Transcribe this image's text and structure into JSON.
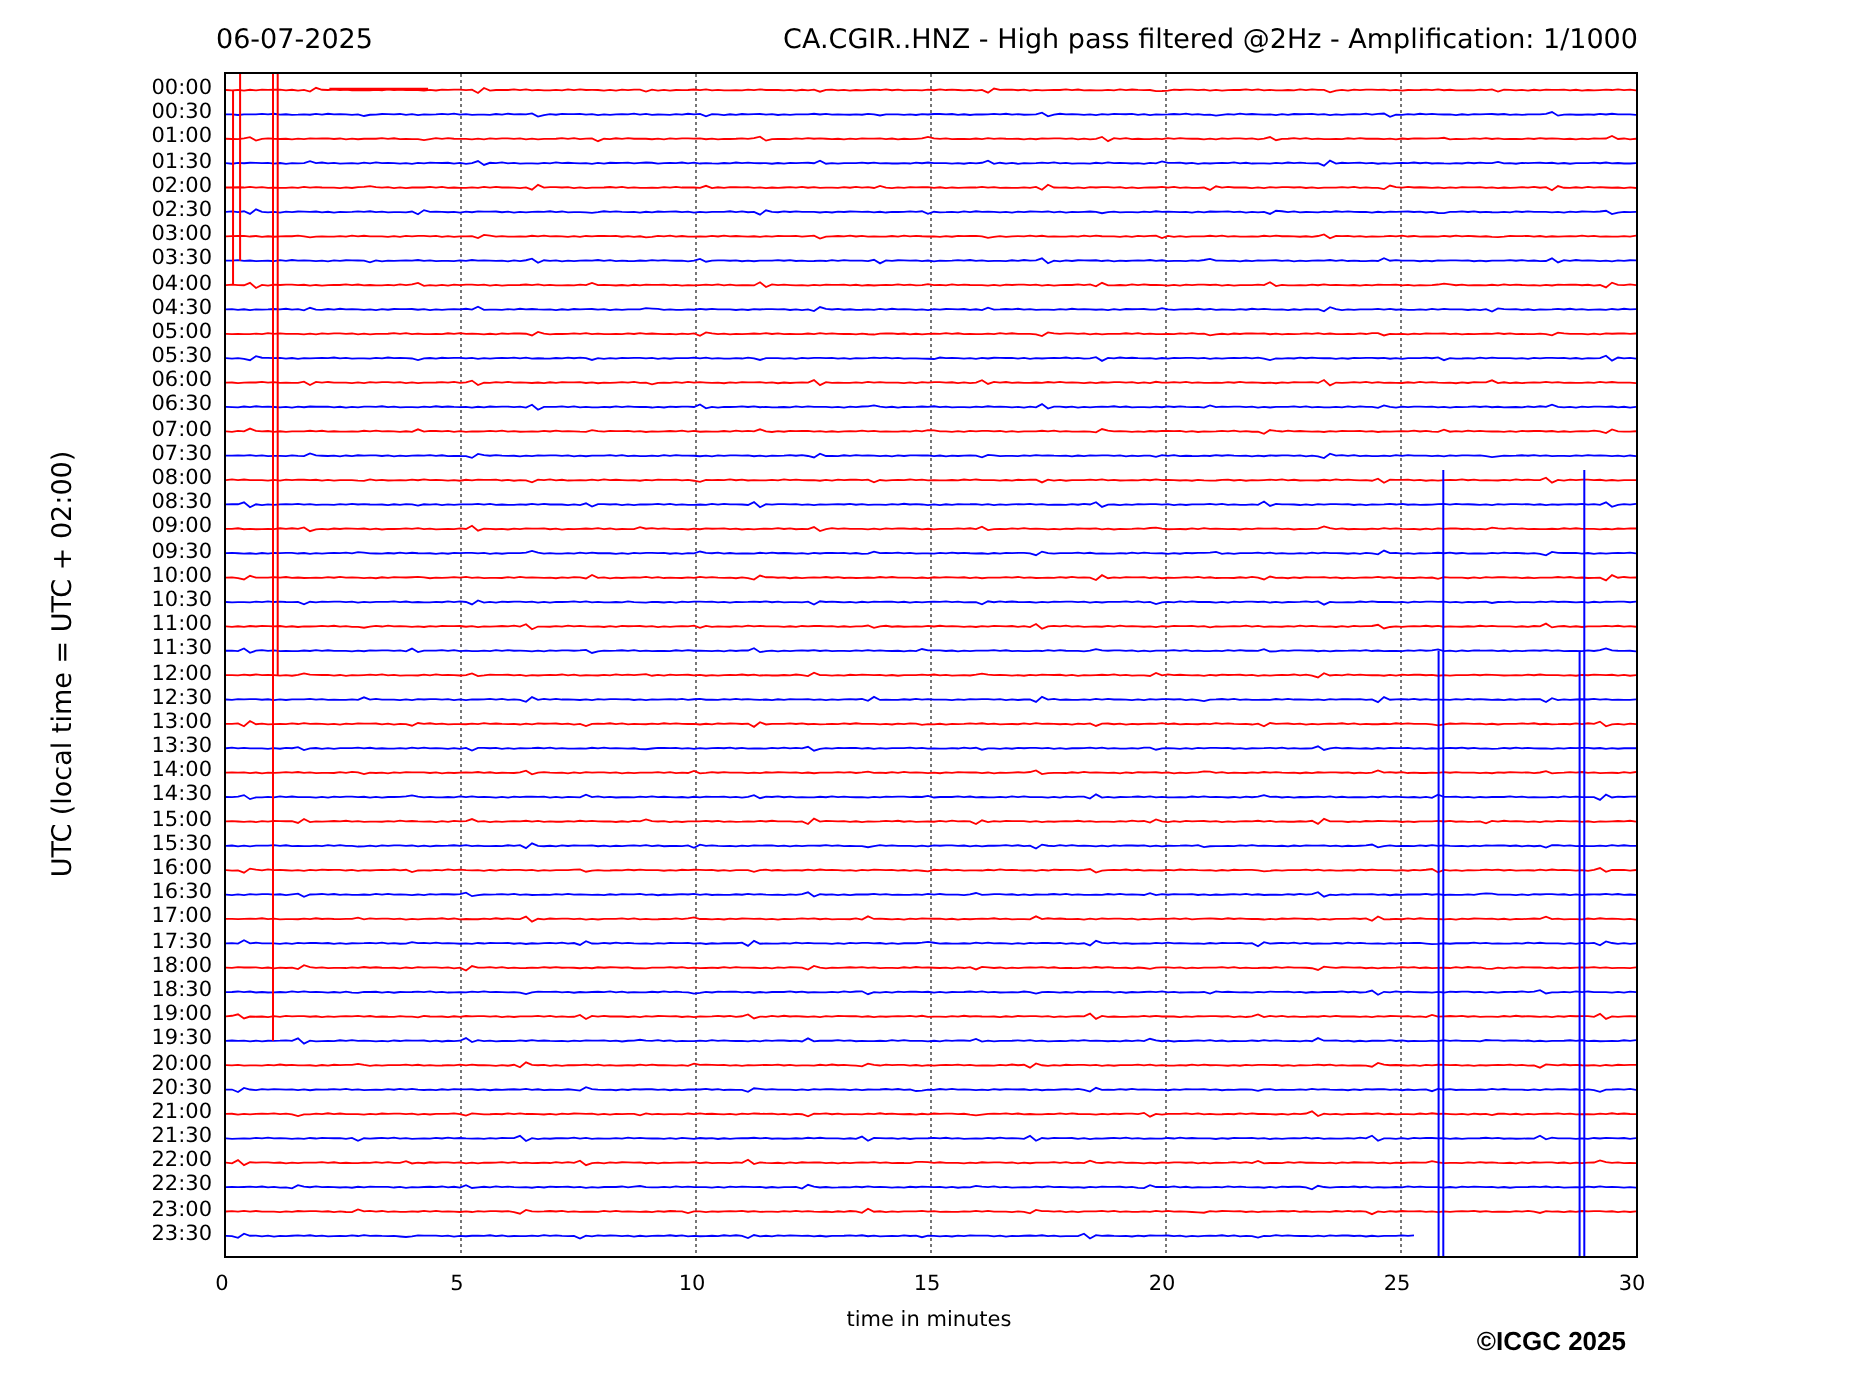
{
  "date": "06-07-2025",
  "title": "CA.CGIR..HNZ - High pass filtered @2Hz - Amplification: 1/1000",
  "plot": {
    "ylabel": "UTC (local time = UTC + 02:00)",
    "xlabel": "time in minutes",
    "xticks": [
      "0",
      "5",
      "10",
      "15",
      "20",
      "25",
      "30"
    ],
    "rows": [
      {
        "label": "00:00",
        "color": "#ff0000"
      },
      {
        "label": "00:30",
        "color": "#0000ff"
      },
      {
        "label": "01:00",
        "color": "#ff0000"
      },
      {
        "label": "01:30",
        "color": "#0000ff"
      },
      {
        "label": "02:00",
        "color": "#ff0000"
      },
      {
        "label": "02:30",
        "color": "#0000ff"
      },
      {
        "label": "03:00",
        "color": "#ff0000"
      },
      {
        "label": "03:30",
        "color": "#0000ff"
      },
      {
        "label": "04:00",
        "color": "#ff0000"
      },
      {
        "label": "04:30",
        "color": "#0000ff"
      },
      {
        "label": "05:00",
        "color": "#ff0000"
      },
      {
        "label": "05:30",
        "color": "#0000ff"
      },
      {
        "label": "06:00",
        "color": "#ff0000"
      },
      {
        "label": "06:30",
        "color": "#0000ff"
      },
      {
        "label": "07:00",
        "color": "#ff0000"
      },
      {
        "label": "07:30",
        "color": "#0000ff"
      },
      {
        "label": "08:00",
        "color": "#ff0000"
      },
      {
        "label": "08:30",
        "color": "#0000ff"
      },
      {
        "label": "09:00",
        "color": "#ff0000"
      },
      {
        "label": "09:30",
        "color": "#0000ff"
      },
      {
        "label": "10:00",
        "color": "#ff0000"
      },
      {
        "label": "10:30",
        "color": "#0000ff"
      },
      {
        "label": "11:00",
        "color": "#ff0000"
      },
      {
        "label": "11:30",
        "color": "#0000ff"
      },
      {
        "label": "12:00",
        "color": "#ff0000"
      },
      {
        "label": "12:30",
        "color": "#0000ff"
      },
      {
        "label": "13:00",
        "color": "#ff0000"
      },
      {
        "label": "13:30",
        "color": "#0000ff"
      },
      {
        "label": "14:00",
        "color": "#ff0000"
      },
      {
        "label": "14:30",
        "color": "#0000ff"
      },
      {
        "label": "15:00",
        "color": "#ff0000"
      },
      {
        "label": "15:30",
        "color": "#0000ff"
      },
      {
        "label": "16:00",
        "color": "#ff0000"
      },
      {
        "label": "16:30",
        "color": "#0000ff"
      },
      {
        "label": "17:00",
        "color": "#ff0000"
      },
      {
        "label": "17:30",
        "color": "#0000ff"
      },
      {
        "label": "18:00",
        "color": "#ff0000"
      },
      {
        "label": "18:30",
        "color": "#0000ff"
      },
      {
        "label": "19:00",
        "color": "#ff0000"
      },
      {
        "label": "19:30",
        "color": "#0000ff"
      },
      {
        "label": "20:00",
        "color": "#ff0000"
      },
      {
        "label": "20:30",
        "color": "#0000ff"
      },
      {
        "label": "21:00",
        "color": "#ff0000"
      },
      {
        "label": "21:30",
        "color": "#0000ff"
      },
      {
        "label": "22:00",
        "color": "#ff0000"
      },
      {
        "label": "22:30",
        "color": "#0000ff"
      },
      {
        "label": "23:00",
        "color": "#ff0000"
      },
      {
        "label": "23:30",
        "color": "#0000ff"
      }
    ]
  },
  "copyright": "©ICGC 2025"
}
